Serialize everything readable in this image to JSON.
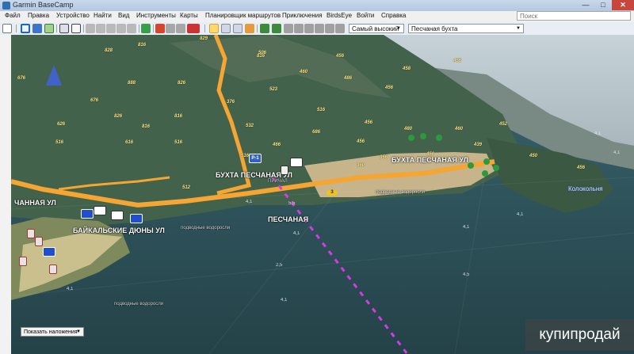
{
  "window": {
    "title": "Garmin BaseCamp",
    "min_glyph": "—",
    "max_glyph": "□",
    "close_glyph": "✕"
  },
  "menu": [
    "Файл",
    "Правка",
    "Устройство",
    "Найти",
    "Вид",
    "Инструменты",
    "Карты",
    "Планировщик маршрутов",
    "Приключения",
    "BirdsEye",
    "Войти",
    "Справка"
  ],
  "search": {
    "placeholder": "Поиск"
  },
  "toolbar": {
    "detail_select": "Самый высокий",
    "map_select": "Песчаная бухта",
    "dropdown_caret": "▼"
  },
  "map": {
    "labels": {
      "bay_street_1": "БУХТА ПЕСЧАНАЯ УЛ",
      "bay_street_2": "БУХТА ПЕСЧАНАЯ УЛ",
      "street_left": "ЧАННАЯ УЛ",
      "dunes_street": "БАЙКАЛЬСКИЕ ДЮНЫ УЛ",
      "peschanaya": "ПЕСЧАНАЯ",
      "underwater_1": "подводные водоросли",
      "underwater_2": "подводные водоросли",
      "underwater_3": "подводные водоросли",
      "kolokolnya": "Колокольня",
      "prichal": "ПРИЧАЛ"
    },
    "elevations": [
      "829",
      "816",
      "816",
      "676",
      "828",
      "888",
      "826",
      "676",
      "826",
      "626",
      "816",
      "816",
      "616",
      "516",
      "516",
      "506",
      "460",
      "456",
      "486",
      "456",
      "516",
      "523",
      "376",
      "532",
      "466",
      "516",
      "686",
      "456",
      "480",
      "460",
      "456",
      "356",
      "456",
      "452",
      "450",
      "456",
      "439",
      "456",
      "458",
      "360",
      "512"
    ],
    "depths": [
      "4,1",
      "4,1",
      "4,1",
      "2,5",
      "4,1",
      "5,5",
      "4,1",
      "4,1",
      "4,5",
      "4,1",
      "4,1"
    ],
    "marker_label": "3",
    "road_sign": "Р-1"
  },
  "overlay": {
    "label": "Показать наложения"
  },
  "watermark": "купипродай",
  "colors": {
    "road": "#f5a531",
    "route": "#d43be4",
    "north_arrow": "#3f63c9"
  }
}
